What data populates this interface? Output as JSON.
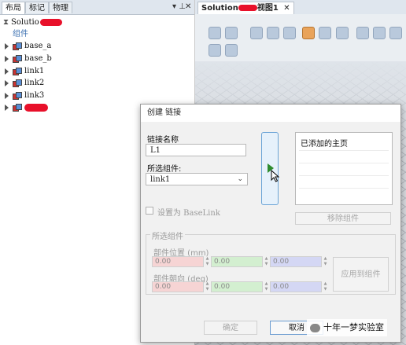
{
  "left_panel": {
    "tabs": [
      {
        "label": "布局",
        "active": true
      },
      {
        "label": "标记",
        "active": false
      },
      {
        "label": "物理",
        "active": false
      }
    ],
    "pin_glyph": "▾ ⊥",
    "close_glyph": "✕",
    "tree": {
      "root_label": "Solutio",
      "group_label": "组件",
      "items": [
        "base_a",
        "base_b",
        "link1",
        "link2",
        "link3"
      ]
    }
  },
  "right_panel": {
    "tab_label_prefix": "Solution",
    "tab_label_suffix": "视图1",
    "tab_close": "✕"
  },
  "dialog": {
    "title": "创建 链接",
    "link_name_label": "链接名称",
    "link_name_value": "L1",
    "selected_component_label": "所选组件:",
    "selected_component_value": "link1",
    "added_list_header": "已添加的主页",
    "remove_button_label": "移除组件",
    "set_baselink_label": "设置为 BaseLink",
    "group_title": "所选组件",
    "position_label": "部件位置 (mm)",
    "orientation_label": "部件朝向 (deg)",
    "position_values": [
      "0.00",
      "0.00",
      "0.00"
    ],
    "orientation_values": [
      "0.00",
      "0.00",
      "0.00"
    ],
    "apply_button_label": "应用到组件",
    "ok_button_label": "确定",
    "cancel_button_label": "取消"
  },
  "watermark": {
    "text": "十年一梦实验室"
  },
  "colors": {
    "play": "#2e8b2e",
    "redaction": "#e8102a",
    "focus_border": "#6aa3d6"
  }
}
